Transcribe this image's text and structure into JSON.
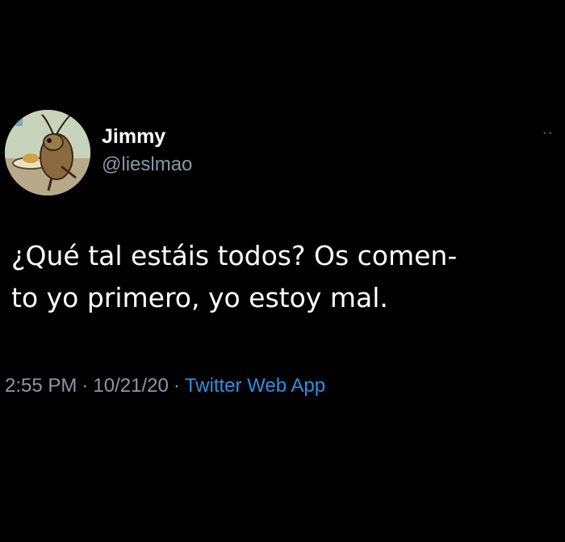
{
  "tweet": {
    "author": {
      "display_name": "Jimmy",
      "handle": "@lieslmao"
    },
    "text": "¿Qué tal estáis todos? Os comen-\nto yo primero, yo estoy mal.",
    "time": "2:55 PM",
    "date": "10/21/20",
    "separator": "·",
    "source": "Twitter Web App"
  },
  "icons": {
    "more": "more-icon",
    "avatar": "cockroach-avatar"
  },
  "colors": {
    "background": "#000000",
    "text": "#ffffff",
    "secondary": "#8b98a5",
    "link": "#2f8fe0"
  }
}
